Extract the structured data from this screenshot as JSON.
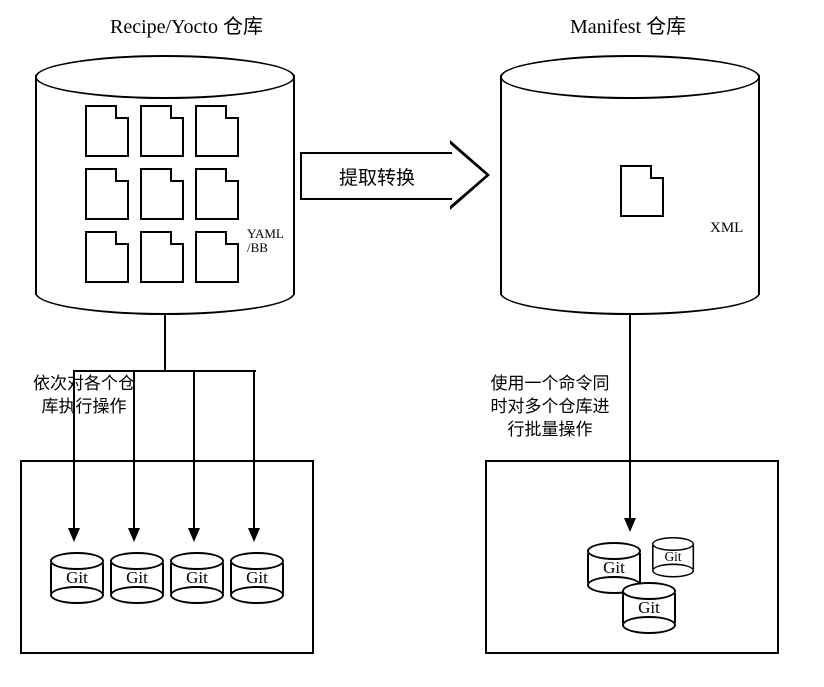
{
  "titles": {
    "left": "Recipe/Yocto 仓库",
    "right": "Manifest 仓库"
  },
  "left_cylinder": {
    "file_count": 9,
    "format_label": "YAML\n/BB"
  },
  "right_cylinder": {
    "file_count": 1,
    "format_label": "XML"
  },
  "arrow": {
    "label": "提取转换"
  },
  "side_text": {
    "left": "依次对各个仓库执行操作",
    "right": "使用一个命令同时对多个仓库进行批量操作"
  },
  "git_label": "Git",
  "left_box": {
    "repo_count": 4
  },
  "right_box": {
    "repo_count": 3
  }
}
